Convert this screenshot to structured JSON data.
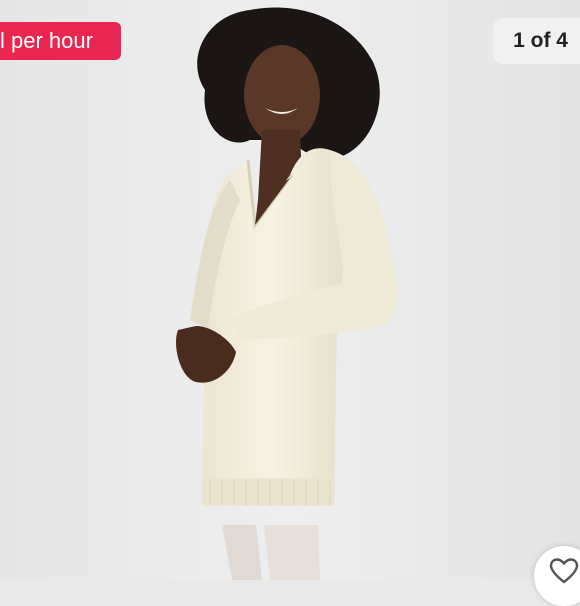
{
  "listing": {
    "rate_badge": "l per hour",
    "image_counter": "1 of 4",
    "like_icon": "heart-outline-icon"
  },
  "colors": {
    "badge_bg": "#e8264f",
    "counter_bg": "#f1f1f1",
    "sweater": "#f4efe0"
  }
}
